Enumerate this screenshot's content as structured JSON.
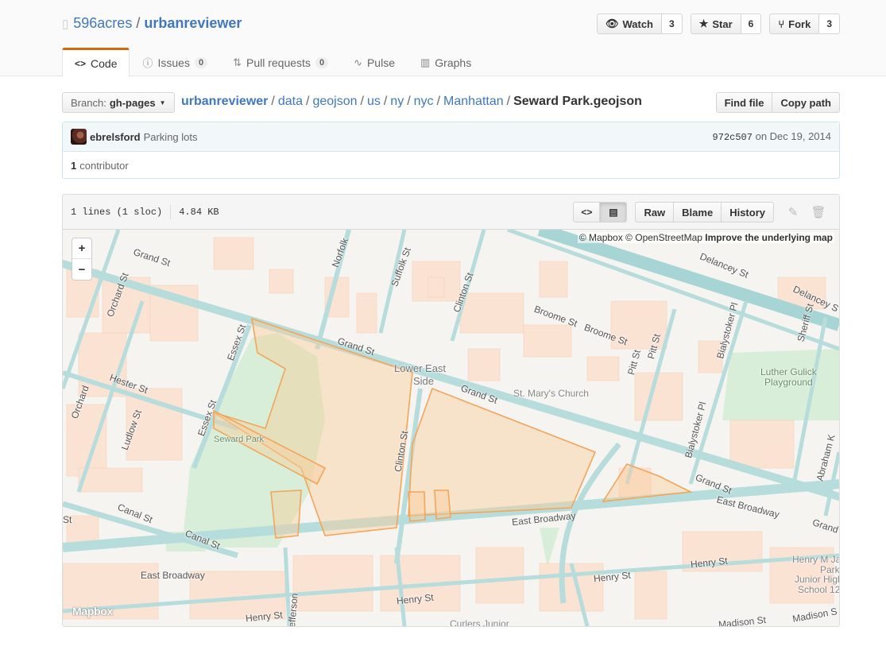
{
  "repo": {
    "owner": "596acres",
    "name": "urbanreviewer"
  },
  "actions": [
    {
      "icon": "eye-icon",
      "glyph": "👁",
      "label": "Watch",
      "count": "3"
    },
    {
      "icon": "star-icon",
      "glyph": "★",
      "label": "Star",
      "count": "6"
    },
    {
      "icon": "fork-icon",
      "glyph": "⑂",
      "label": "Fork",
      "count": "3"
    }
  ],
  "tabs": [
    {
      "icon": "code-icon",
      "glyph": "<>",
      "label": "Code",
      "counter": ""
    },
    {
      "icon": "issue-icon",
      "glyph": "ⓘ",
      "label": "Issues",
      "counter": "0"
    },
    {
      "icon": "pull-request-icon",
      "glyph": "⇅",
      "label": "Pull requests",
      "counter": "0"
    },
    {
      "icon": "pulse-icon",
      "glyph": "∿",
      "label": "Pulse",
      "counter": ""
    },
    {
      "icon": "graph-icon",
      "glyph": "▥",
      "label": "Graphs",
      "counter": ""
    }
  ],
  "branch": {
    "prefix": "Branch:",
    "name": "gh-pages"
  },
  "breadcrumb": {
    "root": "urbanreviewer",
    "parts": [
      "data",
      "geojson",
      "us",
      "ny",
      "nyc",
      "Manhattan"
    ],
    "final": "Seward Park.geojson"
  },
  "file_nav": {
    "find_file": "Find file",
    "copy_path": "Copy path"
  },
  "commit": {
    "author": "ebrelsford",
    "message": "Parking lots",
    "sha": "972c507",
    "date": "on Dec 19, 2014",
    "contributors_count": "1",
    "contributors_label": "contributor"
  },
  "file": {
    "lines": "1 lines (1 sloc)",
    "size": "4.84 KB",
    "raw": "Raw",
    "blame": "Blame",
    "history": "History",
    "code_toggle": "<>",
    "rendered_toggle": "▤"
  },
  "map": {
    "attribution_prefix": "© Mapbox © OpenStreetMap",
    "attribution_link": "Improve the underlying map",
    "zoom_in": "+",
    "zoom_out": "−",
    "logo": "Mapbox",
    "labels": {
      "grand_st_1": "Grand St",
      "grand_st_2": "Grand St",
      "grand_st_3": "Grand St",
      "grand_st_4": "Grand St",
      "grand_st_5": "Grand",
      "delancey_1": "Delancey St",
      "delancey_2": "Delancey S",
      "norfolk": "Norfolk",
      "suffolk": "Suffolk St",
      "clinton_1": "Clinton St",
      "clinton_2": "Clinton St",
      "broome": "Broome St",
      "broome_2": "Broome St",
      "orchard_1": "Orchard St",
      "orchard_2": "Orchard",
      "essex_1": "Essex St",
      "essex_2": "Essex St",
      "hester": "Hester St",
      "ludlow": "Ludlow St",
      "les_1": "Lower East",
      "les_2": "Side",
      "st_marys": "St. Mary's Church",
      "pitt_1": "Pitt St",
      "pitt_2": "Pitt St",
      "bialystoker_1": "Bialystoker Pl",
      "bialystoker_2": "Bialystoker Pl",
      "sheriff": "Sheriff St",
      "luther_1": "Luther Gulick",
      "luther_2": "Playground",
      "abraham": "Abraham K",
      "seward_park": "Seward Park",
      "canal_1": "Canal St",
      "canal_2": "Canal St",
      "east_broadway_1": "East Broadway",
      "east_broadway_2": "East Broadway",
      "east_broadway_3": "East Broadway",
      "henry_1": "Henry St",
      "henry_2": "Henry St",
      "henry_3": "Henry St",
      "henry_4": "Henry St",
      "jefferson": "Jefferson",
      "madison_1": "Madison St",
      "madison_2": "Madison S",
      "curlers": "Curlers Junior",
      "school_1": "Henry M Ja",
      "school_2": "Park",
      "school_3": "Junior High",
      "school_4": "School 12",
      "st_fragment": "St"
    }
  }
}
